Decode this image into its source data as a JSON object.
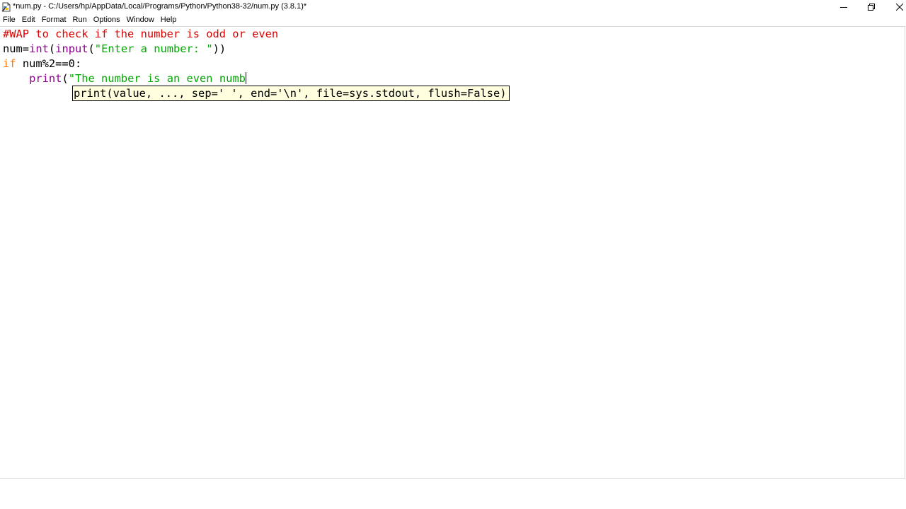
{
  "window": {
    "title": "*num.py - C:/Users/hp/AppData/Local/Programs/Python/Python38-32/num.py (3.8.1)*",
    "icon": "idle-file-icon",
    "controls": {
      "minimize": "minimize-icon",
      "maximize": "restore-icon",
      "close": "close-icon"
    }
  },
  "menubar": {
    "items": [
      "File",
      "Edit",
      "Format",
      "Run",
      "Options",
      "Window",
      "Help"
    ]
  },
  "editor": {
    "lines": [
      [
        {
          "t": "#WAP to check if the number is odd or even",
          "k": "comment"
        }
      ],
      [
        {
          "t": "num=",
          "k": "default"
        },
        {
          "t": "int",
          "k": "builtin"
        },
        {
          "t": "(",
          "k": "default"
        },
        {
          "t": "input",
          "k": "builtin"
        },
        {
          "t": "(",
          "k": "default"
        },
        {
          "t": "\"Enter a number: \"",
          "k": "string"
        },
        {
          "t": "))",
          "k": "default"
        }
      ],
      [
        {
          "t": "if",
          "k": "keyword"
        },
        {
          "t": " num%2==0:",
          "k": "default"
        }
      ],
      [
        {
          "t": "    ",
          "k": "default"
        },
        {
          "t": "print",
          "k": "builtin"
        },
        {
          "t": "(",
          "k": "default"
        },
        {
          "t": "\"The number is an even numb",
          "k": "string"
        }
      ]
    ],
    "cursor_line": 4
  },
  "calltip": {
    "text": "print(value, ..., sep=' ', end='\\n', file=sys.stdout, flush=False)"
  },
  "colors": {
    "comment": "#dd0000",
    "keyword": "#ff7700",
    "builtin": "#900090",
    "string": "#00aa00",
    "calltip_bg": "#ffffe0"
  }
}
